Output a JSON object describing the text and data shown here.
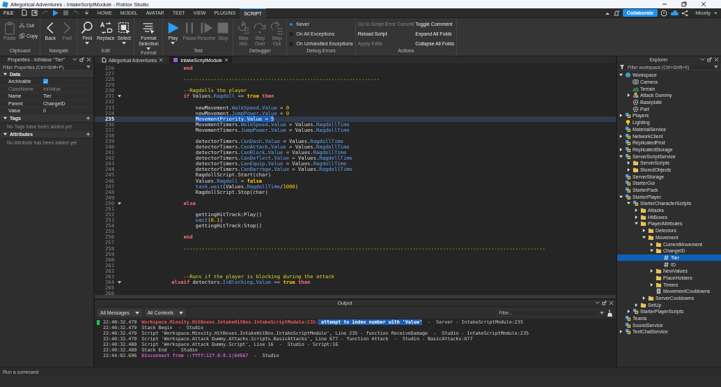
{
  "window": {
    "title": "Allegorical Adventures - IntakeScriptModule - Roblox Studio"
  },
  "menu": {
    "file": "FILE",
    "tabs": [
      {
        "label": "HOME",
        "selected": false
      },
      {
        "label": "MODEL",
        "selected": false
      },
      {
        "label": "AVATAR",
        "selected": false
      },
      {
        "label": "TEST",
        "selected": false
      },
      {
        "label": "VIEW",
        "selected": false
      },
      {
        "label": "PLUGINS",
        "selected": false
      },
      {
        "label": "SCRIPT",
        "selected": true
      }
    ],
    "collaborate": "Collaborate",
    "user": "Mioxity"
  },
  "ribbon": [
    {
      "label": "Clipboard",
      "columns": [
        [
          {
            "kind": "paste",
            "label": "Paste",
            "disabled": true
          }
        ],
        [
          {
            "kind": "cut",
            "label": "Cut",
            "disabled": false
          },
          {
            "kind": "copy",
            "label": "Copy",
            "disabled": false
          }
        ]
      ]
    },
    {
      "label": "Navigate",
      "columns": [
        [
          {
            "kind": "back",
            "label": "Back",
            "disabled": false
          }
        ],
        [
          {
            "kind": "fwd",
            "label": "Fwd",
            "disabled": true
          }
        ]
      ]
    },
    {
      "label": "Edit",
      "columns": [
        [
          {
            "kind": "find",
            "label": "Find",
            "disabled": false,
            "dropdown": true
          }
        ],
        [
          {
            "kind": "replace",
            "label": "Replace",
            "disabled": false,
            "dropdown": false
          }
        ],
        [
          {
            "kind": "select",
            "label": "Select",
            "disabled": false,
            "dropdown": true
          }
        ]
      ]
    },
    {
      "label": "Format",
      "columns": [
        [
          {
            "kind": "format",
            "label": "Format Selection",
            "disabled": false,
            "dropdown": true
          }
        ]
      ]
    },
    {
      "label": "Test",
      "columns": [
        [
          {
            "kind": "play",
            "label": "Play",
            "disabled": false,
            "dropdown": true
          }
        ],
        [
          {
            "kind": "pause",
            "label": "Pause",
            "disabled": true,
            "dropdown": false
          }
        ],
        [
          {
            "kind": "resume",
            "label": "Resume",
            "disabled": true,
            "dropdown": false
          }
        ],
        [
          {
            "kind": "stop",
            "label": "Stop",
            "disabled": true,
            "dropdown": false
          }
        ]
      ]
    },
    {
      "label": "Debugger",
      "columns": [
        [
          {
            "kind": "stepinto",
            "label": "Step Into",
            "disabled": true,
            "dropdown": false
          }
        ],
        [
          {
            "kind": "stepover",
            "label": "Step Over",
            "disabled": true,
            "dropdown": false
          }
        ],
        [
          {
            "kind": "stepout",
            "label": "Step Out",
            "disabled": true,
            "dropdown": false
          }
        ]
      ]
    },
    {
      "label": "Debug Errors",
      "columns": [
        [
          {
            "kind": "radio",
            "label": "Never",
            "selected": true
          },
          {
            "kind": "radio",
            "label": "On All Exceptions",
            "selected": false
          },
          {
            "kind": "radio",
            "label": "On Unhandled Exceptions",
            "selected": false
          }
        ]
      ]
    },
    {
      "label": "Actions",
      "columns": [
        [
          {
            "kind": "action",
            "label": "Go to Script Error",
            "disabled": true
          },
          {
            "kind": "action",
            "label": "Reload Script",
            "disabled": false
          },
          {
            "kind": "action",
            "label": "Apply Edits",
            "disabled": true
          }
        ],
        [
          {
            "kind": "action",
            "label": "Commit",
            "disabled": true
          }
        ],
        [
          {
            "kind": "action",
            "label": "Toggle Comment",
            "disabled": false
          },
          {
            "kind": "action",
            "label": "Expand All Folds",
            "disabled": false
          },
          {
            "kind": "action",
            "label": "Collapse All Folds",
            "disabled": false
          }
        ]
      ]
    }
  ],
  "properties": {
    "title": "Properties - IntValue \"Tier\"",
    "filter_placeholder": "Filter Properties (Ctrl+Shift+P)",
    "sections": [
      {
        "label": "Data",
        "expanded": true,
        "rows": [
          {
            "name": "Archivable",
            "kind": "check",
            "checked": true,
            "disabled": false
          },
          {
            "name": "ClassName",
            "kind": "text",
            "value": "IntValue",
            "disabled": true
          },
          {
            "name": "Name",
            "kind": "text",
            "value": "Tier",
            "disabled": false
          },
          {
            "name": "Parent",
            "kind": "text",
            "value": "ChangeID",
            "disabled": false
          },
          {
            "name": "Value",
            "kind": "text",
            "value": "0",
            "disabled": false
          }
        ]
      },
      {
        "label": "Tags",
        "expanded": true,
        "empty": "No Tags have been added yet"
      },
      {
        "label": "Attributes",
        "expanded": true,
        "empty": "No Attribute has been added yet"
      }
    ]
  },
  "editor": {
    "tabs": [
      {
        "label": "Allegorical Adventures",
        "selected": false
      },
      {
        "label": "IntakeScriptModule",
        "selected": true
      }
    ],
    "lines": [
      {
        "number": "226",
        "fold": false,
        "selected": false,
        "tokens": [
          {
            "text": "                    end",
            "kind": "k"
          }
        ]
      },
      {
        "number": "227",
        "fold": false,
        "selected": false
      },
      {
        "number": "228",
        "fold": false,
        "selected": false,
        "tokens": [
          {
            "text": "                    -----------------------------------------------------------------",
            "kind": "c"
          }
        ]
      },
      {
        "number": "229",
        "fold": false,
        "selected": false
      },
      {
        "number": "230",
        "fold": false,
        "selected": false,
        "tokens": [
          {
            "text": "                    --Ragdolls the player",
            "kind": "c"
          }
        ]
      },
      {
        "number": "231",
        "fold": true,
        "selected": false,
        "tokens": [
          {
            "text": "                    if",
            "kind": "k"
          },
          {
            "text": " Values.",
            "kind": "p"
          },
          {
            "text": "Ragdoll",
            "kind": "f"
          },
          {
            "text": " == ",
            "kind": "p"
          },
          {
            "text": "true",
            "kind": "b"
          },
          {
            "text": " then",
            "kind": "k"
          }
        ]
      },
      {
        "number": "232",
        "fold": false,
        "selected": false
      },
      {
        "number": "233",
        "fold": false,
        "selected": false,
        "tokens": [
          {
            "text": "                        newMovement.",
            "kind": "p"
          },
          {
            "text": "WalkSpeed",
            "kind": "f"
          },
          {
            "text": ".",
            "kind": "p"
          },
          {
            "text": "Value",
            "kind": "f"
          },
          {
            "text": " = ",
            "kind": "p"
          },
          {
            "text": "0",
            "kind": "n"
          }
        ]
      },
      {
        "number": "234",
        "fold": false,
        "selected": false,
        "tokens": [
          {
            "text": "                        newMovement.",
            "kind": "p"
          },
          {
            "text": "JumpPower",
            "kind": "f"
          },
          {
            "text": ".",
            "kind": "p"
          },
          {
            "text": "Value",
            "kind": "f"
          },
          {
            "text": " = ",
            "kind": "p"
          },
          {
            "text": "0",
            "kind": "n"
          }
        ]
      },
      {
        "number": "235",
        "fold": false,
        "selected": true,
        "tokens": [
          {
            "text": "                        MovementPriority.Value = 5",
            "kind": "s"
          }
        ]
      },
      {
        "number": "236",
        "fold": false,
        "selected": false,
        "tokens": [
          {
            "text": "                        MovementTimers.",
            "kind": "p"
          },
          {
            "text": "WalkSpeed",
            "kind": "f"
          },
          {
            "text": ".",
            "kind": "p"
          },
          {
            "text": "Value",
            "kind": "f"
          },
          {
            "text": " = Values.",
            "kind": "p"
          },
          {
            "text": "RagdollTime",
            "kind": "f"
          }
        ]
      },
      {
        "number": "237",
        "fold": false,
        "selected": false,
        "tokens": [
          {
            "text": "                        MovementTimers.",
            "kind": "p"
          },
          {
            "text": "JumpPower",
            "kind": "f"
          },
          {
            "text": ".",
            "kind": "p"
          },
          {
            "text": "Value",
            "kind": "f"
          },
          {
            "text": " = Values.",
            "kind": "p"
          },
          {
            "text": "RagdollTime",
            "kind": "f"
          }
        ]
      },
      {
        "number": "238",
        "fold": false,
        "selected": false
      },
      {
        "number": "239",
        "fold": false,
        "selected": false,
        "tokens": [
          {
            "text": "                        detectorTimers.",
            "kind": "p"
          },
          {
            "text": "CanDash",
            "kind": "f"
          },
          {
            "text": ".",
            "kind": "p"
          },
          {
            "text": "Value",
            "kind": "f"
          },
          {
            "text": " = Values.",
            "kind": "p"
          },
          {
            "text": "RagdollTime",
            "kind": "f"
          }
        ]
      },
      {
        "number": "240",
        "fold": false,
        "selected": false,
        "tokens": [
          {
            "text": "                        detectorTimers.",
            "kind": "p"
          },
          {
            "text": "CanAttack",
            "kind": "f"
          },
          {
            "text": ".",
            "kind": "p"
          },
          {
            "text": "Value",
            "kind": "f"
          },
          {
            "text": " = Values.",
            "kind": "p"
          },
          {
            "text": "RagdollTime",
            "kind": "f"
          }
        ]
      },
      {
        "number": "241",
        "fold": false,
        "selected": false,
        "tokens": [
          {
            "text": "                        detectorTimers.",
            "kind": "p"
          },
          {
            "text": "CanBlock",
            "kind": "f"
          },
          {
            "text": ".",
            "kind": "p"
          },
          {
            "text": "Value",
            "kind": "f"
          },
          {
            "text": " = Values.",
            "kind": "p"
          },
          {
            "text": "RagdollTime",
            "kind": "f"
          }
        ]
      },
      {
        "number": "242",
        "fold": false,
        "selected": false,
        "tokens": [
          {
            "text": "                        detectorTimers.",
            "kind": "p"
          },
          {
            "text": "CanDeflect",
            "kind": "f"
          },
          {
            "text": ".",
            "kind": "p"
          },
          {
            "text": "Value",
            "kind": "f"
          },
          {
            "text": " = Values.",
            "kind": "p"
          },
          {
            "text": "RagdollTime",
            "kind": "f"
          }
        ]
      },
      {
        "number": "243",
        "fold": false,
        "selected": false,
        "tokens": [
          {
            "text": "                        detectorTimers.",
            "kind": "p"
          },
          {
            "text": "CanEquip",
            "kind": "f"
          },
          {
            "text": ".",
            "kind": "p"
          },
          {
            "text": "Value",
            "kind": "f"
          },
          {
            "text": " = Values.",
            "kind": "p"
          },
          {
            "text": "RagdollTime",
            "kind": "f"
          }
        ]
      },
      {
        "number": "244",
        "fold": false,
        "selected": false,
        "tokens": [
          {
            "text": "                        detectorTimers.",
            "kind": "p"
          },
          {
            "text": "CanBarrage",
            "kind": "f"
          },
          {
            "text": ".",
            "kind": "p"
          },
          {
            "text": "Value",
            "kind": "f"
          },
          {
            "text": " = Values.",
            "kind": "p"
          },
          {
            "text": "RagdollTime",
            "kind": "f"
          }
        ]
      },
      {
        "number": "245",
        "fold": false,
        "selected": false,
        "tokens": [
          {
            "text": "                        RagdollScript.Start(char)",
            "kind": "p"
          }
        ]
      },
      {
        "number": "246",
        "fold": false,
        "selected": false,
        "tokens": [
          {
            "text": "                        Values.",
            "kind": "p"
          },
          {
            "text": "Ragdoll",
            "kind": "f"
          },
          {
            "text": " = ",
            "kind": "p"
          },
          {
            "text": "false",
            "kind": "b"
          }
        ]
      },
      {
        "number": "247",
        "fold": false,
        "selected": false,
        "tokens": [
          {
            "text": "                        task",
            "kind": "f"
          },
          {
            "text": ".",
            "kind": "p"
          },
          {
            "text": "wait",
            "kind": "f"
          },
          {
            "text": "(Values.",
            "kind": "p"
          },
          {
            "text": "RagdollTime",
            "kind": "f"
          },
          {
            "text": "/",
            "kind": "p"
          },
          {
            "text": "1000",
            "kind": "n"
          },
          {
            "text": ")",
            "kind": "p"
          }
        ]
      },
      {
        "number": "248",
        "fold": false,
        "selected": false,
        "tokens": [
          {
            "text": "                        RagdollScript.Stop(char)",
            "kind": "p"
          }
        ]
      },
      {
        "number": "249",
        "fold": false,
        "selected": false
      },
      {
        "number": "250",
        "fold": true,
        "selected": false,
        "tokens": [
          {
            "text": "                    else",
            "kind": "k"
          }
        ]
      },
      {
        "number": "251",
        "fold": false,
        "selected": false
      },
      {
        "number": "252",
        "fold": false,
        "selected": false,
        "tokens": [
          {
            "text": "                        gettingHitTrack:Play()",
            "kind": "p"
          }
        ]
      },
      {
        "number": "253",
        "fold": false,
        "selected": false,
        "tokens": [
          {
            "text": "                        wait",
            "kind": "f"
          },
          {
            "text": "(",
            "kind": "p"
          },
          {
            "text": "0.1",
            "kind": "n"
          },
          {
            "text": ")",
            "kind": "p"
          }
        ]
      },
      {
        "number": "254",
        "fold": false,
        "selected": false,
        "tokens": [
          {
            "text": "                        gettingHitTrack:Stop()",
            "kind": "p"
          }
        ]
      },
      {
        "number": "255",
        "fold": false,
        "selected": false
      },
      {
        "number": "256",
        "fold": false,
        "selected": false,
        "tokens": [
          {
            "text": "                    end",
            "kind": "k"
          }
        ]
      },
      {
        "number": "257",
        "fold": false,
        "selected": false
      },
      {
        "number": "258",
        "fold": false,
        "selected": false,
        "tokens": [
          {
            "text": "                    ------------------------------------------------------------------------------------------------------------------------",
            "kind": "c"
          }
        ]
      },
      {
        "number": "259",
        "fold": false,
        "selected": false
      },
      {
        "number": "260",
        "fold": false,
        "selected": false
      },
      {
        "number": "261",
        "fold": false,
        "selected": false
      },
      {
        "number": "262",
        "fold": false,
        "selected": false
      },
      {
        "number": "263",
        "fold": false,
        "selected": false,
        "tokens": [
          {
            "text": "                    --Runs if the player is blocking during the attack",
            "kind": "c"
          }
        ]
      },
      {
        "number": "264",
        "fold": true,
        "selected": false,
        "tokens": [
          {
            "text": "                elseif",
            "kind": "k"
          },
          {
            "text": " detectors.",
            "kind": "p"
          },
          {
            "text": "IsBlocking",
            "kind": "f"
          },
          {
            "text": ".",
            "kind": "p"
          },
          {
            "text": "Value",
            "kind": "f"
          },
          {
            "text": " == ",
            "kind": "p"
          },
          {
            "text": "true",
            "kind": "b"
          },
          {
            "text": " then",
            "kind": "k"
          }
        ]
      },
      {
        "number": "265",
        "fold": false,
        "selected": false
      },
      {
        "number": "266",
        "fold": false,
        "selected": false
      }
    ]
  },
  "output": {
    "title": "Output",
    "messages_filter": "All Messages",
    "contexts_filter": "All Contexts",
    "filter_placeholder": "Filter...",
    "lines": [
      {
        "time": "22:40:32.479",
        "marker": true,
        "tokens": [
          {
            "text": "Workspace.Mioxity.HitBoxes.IntakeHitBox.IntakeScriptModule:235:",
            "kind": "e"
          },
          {
            "text": " attempt to index number with 'Value'",
            "kind": "h"
          },
          {
            "text": "  -  Server - IntakeScriptModule:235",
            "kind": "p"
          }
        ]
      },
      {
        "time": "22:40:32.479",
        "marker": false,
        "tokens": [
          {
            "text": "Stack Begin  -  Studio",
            "kind": "p"
          }
        ]
      },
      {
        "time": "22:40:32.479",
        "marker": false,
        "tokens": [
          {
            "text": "Script 'Workspace.Mioxity.HitBoxes.IntakeHitBox.IntakeScriptModule', Line 235 - function ReceiveDamage  -  Studio - IntakeScriptModule:235",
            "kind": "p"
          }
        ]
      },
      {
        "time": "22:40:32.479",
        "marker": false,
        "tokens": [
          {
            "text": "Script 'Workspace.Attack Dummy.Attacks.Scripts.BasicAttacks', Line 677 - function Attack  -  Studio - BasicAttacks:677",
            "kind": "p"
          }
        ]
      },
      {
        "time": "22:40:32.480",
        "marker": false,
        "tokens": [
          {
            "text": "Script 'Workspace.Attack Dummy.Script', Line 16  -  Studio - Script:16",
            "kind": "p"
          }
        ]
      },
      {
        "time": "22:40:32.480",
        "marker": false,
        "tokens": [
          {
            "text": "Stack End  -  Studio",
            "kind": "p"
          }
        ]
      },
      {
        "time": "22:44:02.696",
        "marker": false,
        "tokens": [
          {
            "text": "Disconnect from ::ffff:127.0.0.1|64667",
            "kind": "m"
          },
          {
            "text": "  -  Studio",
            "kind": "p"
          }
        ]
      }
    ]
  },
  "explorer": {
    "title": "Explorer",
    "filter_placeholder": "Filter workspace (Ctrl+Shift+X)",
    "items": [
      {
        "label": "Workspace",
        "kind": "world",
        "expanded": true,
        "selected": false,
        "children": [
          {
            "label": "Camera",
            "kind": "camera",
            "selected": false
          },
          {
            "label": "Terrain",
            "kind": "terrain",
            "selected": false
          },
          {
            "label": "Attack Dummy",
            "kind": "model",
            "expanded": false,
            "selected": false
          },
          {
            "label": "Baseplate",
            "kind": "part",
            "selected": false
          },
          {
            "label": "Part",
            "kind": "part",
            "selected": false
          }
        ]
      },
      {
        "label": "Players",
        "kind": "service",
        "expanded": false,
        "selected": false
      },
      {
        "label": "Lighting",
        "kind": "bulb",
        "selected": false
      },
      {
        "label": "MaterialService",
        "kind": "service",
        "selected": false
      },
      {
        "label": "NetworkClient",
        "kind": "service",
        "expanded": false,
        "selected": false
      },
      {
        "label": "ReplicatedFirst",
        "kind": "service",
        "selected": false
      },
      {
        "label": "ReplicatedStorage",
        "kind": "service",
        "expanded": false,
        "selected": false
      },
      {
        "label": "ServerScriptService",
        "kind": "service",
        "expanded": true,
        "selected": false,
        "children": [
          {
            "label": "ServerScripts",
            "kind": "folder",
            "expanded": false,
            "selected": false
          },
          {
            "label": "StoredObjects",
            "kind": "folder",
            "expanded": false,
            "selected": false
          }
        ]
      },
      {
        "label": "ServerStorage",
        "kind": "service",
        "selected": false
      },
      {
        "label": "StarterGui",
        "kind": "service",
        "selected": false
      },
      {
        "label": "StarterPack",
        "kind": "service",
        "selected": false
      },
      {
        "label": "StarterPlayer",
        "kind": "service",
        "expanded": true,
        "selected": false,
        "children": [
          {
            "label": "StarterCharacterScripts",
            "kind": "service",
            "expanded": true,
            "selected": false,
            "children": [
              {
                "label": "Attacks",
                "kind": "folder",
                "expanded": false,
                "selected": false
              },
              {
                "label": "HitBoxes",
                "kind": "folder",
                "expanded": false,
                "selected": false
              },
              {
                "label": "PlayerAttributes",
                "kind": "folder",
                "expanded": true,
                "selected": false,
                "children": [
                  {
                    "label": "Detectors",
                    "kind": "folder",
                    "expanded": false,
                    "selected": false
                  },
                  {
                    "label": "Movement",
                    "kind": "folder",
                    "expanded": true,
                    "selected": false,
                    "children": [
                      {
                        "label": "CurrentMovement",
                        "kind": "folder",
                        "expanded": false,
                        "selected": false
                      },
                      {
                        "label": "ChangeID",
                        "kind": "folder",
                        "expanded": true,
                        "selected": false,
                        "children": [
                          {
                            "label": "Tier",
                            "kind": "value",
                            "selected": true
                          },
                          {
                            "label": "ID",
                            "kind": "value",
                            "selected": false
                          }
                        ]
                      },
                      {
                        "label": "NewValues",
                        "kind": "folder",
                        "expanded": false,
                        "selected": false
                      },
                      {
                        "label": "PlaceHolders",
                        "kind": "folder",
                        "selected": false
                      },
                      {
                        "label": "Timers",
                        "kind": "folder",
                        "expanded": false,
                        "selected": false
                      },
                      {
                        "label": "MovementCooldowns",
                        "kind": "script",
                        "selected": false
                      }
                    ]
                  },
                  {
                    "label": "ServerCooldowns",
                    "kind": "folder",
                    "expanded": false,
                    "selected": false
                  }
                ]
              },
              {
                "label": "SetUp",
                "kind": "folder",
                "expanded": false,
                "selected": false
              }
            ]
          },
          {
            "label": "StarterPlayerScripts",
            "kind": "service",
            "expanded": false,
            "selected": false
          }
        ]
      },
      {
        "label": "Teams",
        "kind": "service",
        "selected": false
      },
      {
        "label": "SoundService",
        "kind": "service",
        "selected": false
      },
      {
        "label": "TextChatService",
        "kind": "service",
        "expanded": false,
        "selected": false
      }
    ]
  },
  "command_bar": {
    "placeholder": "Run a command"
  }
}
